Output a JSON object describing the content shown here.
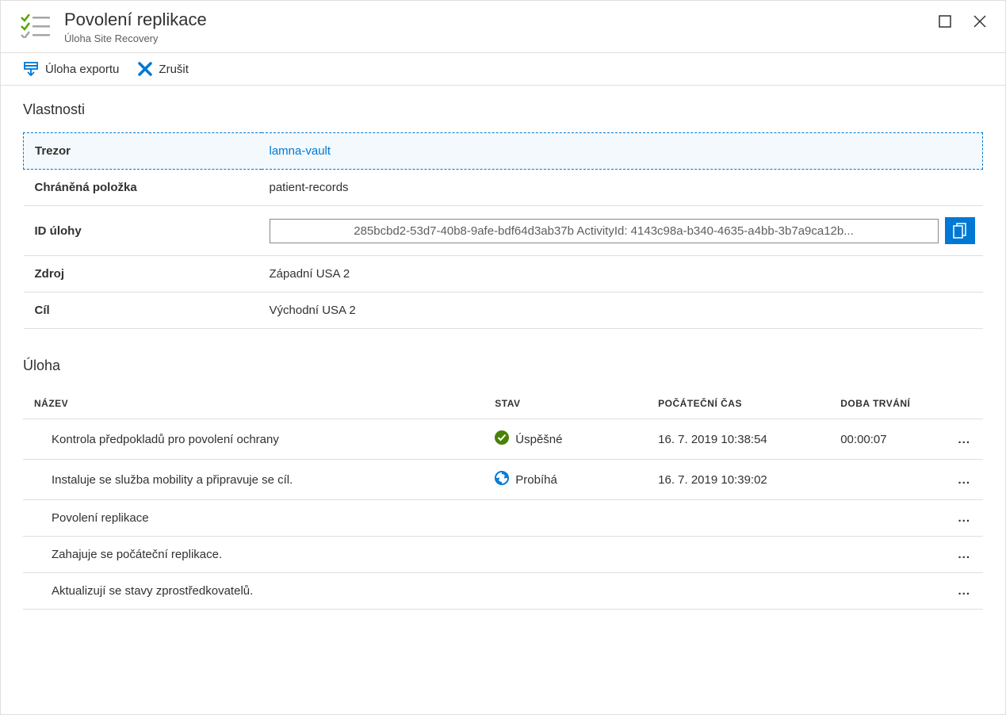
{
  "header": {
    "title": "Povolení replikace",
    "subtitle": "Úloha Site Recovery"
  },
  "toolbar": {
    "export_label": "Úloha exportu",
    "cancel_label": "Zrušit"
  },
  "sections": {
    "properties_title": "Vlastnosti",
    "task_title": "Úloha"
  },
  "properties": {
    "vault_label": "Trezor",
    "vault_value": "lamna-vault",
    "protected_label": "Chráněná položka",
    "protected_value": "patient-records",
    "jobid_label": "ID úlohy",
    "jobid_value": "285bcbd2-53d7-40b8-9afe-bdf64d3ab37b ActivityId: 4143c98a-b340-4635-a4bb-3b7a9ca12b...",
    "source_label": "Zdroj",
    "source_value": "Západní USA 2",
    "target_label": "Cíl",
    "target_value": "Východní USA 2"
  },
  "task_columns": {
    "name": "NÁZEV",
    "status": "STAV",
    "start": "POČÁTEČNÍ ČAS",
    "duration": "DOBA TRVÁNÍ"
  },
  "tasks": [
    {
      "name": "Kontrola předpokladů pro povolení ochrany",
      "status": "Úspěšné",
      "status_type": "success",
      "start": "16. 7. 2019 10:38:54",
      "duration": "00:00:07"
    },
    {
      "name": "Instaluje se služba mobility a připravuje se cíl.",
      "status": "Probíhá",
      "status_type": "progress",
      "start": "16. 7. 2019 10:39:02",
      "duration": ""
    },
    {
      "name": "Povolení replikace",
      "status": "",
      "status_type": "",
      "start": "",
      "duration": ""
    },
    {
      "name": "Zahajuje se počáteční replikace.",
      "status": "",
      "status_type": "",
      "start": "",
      "duration": ""
    },
    {
      "name": "Aktualizují se stavy zprostředkovatelů.",
      "status": "",
      "status_type": "",
      "start": "",
      "duration": ""
    }
  ]
}
